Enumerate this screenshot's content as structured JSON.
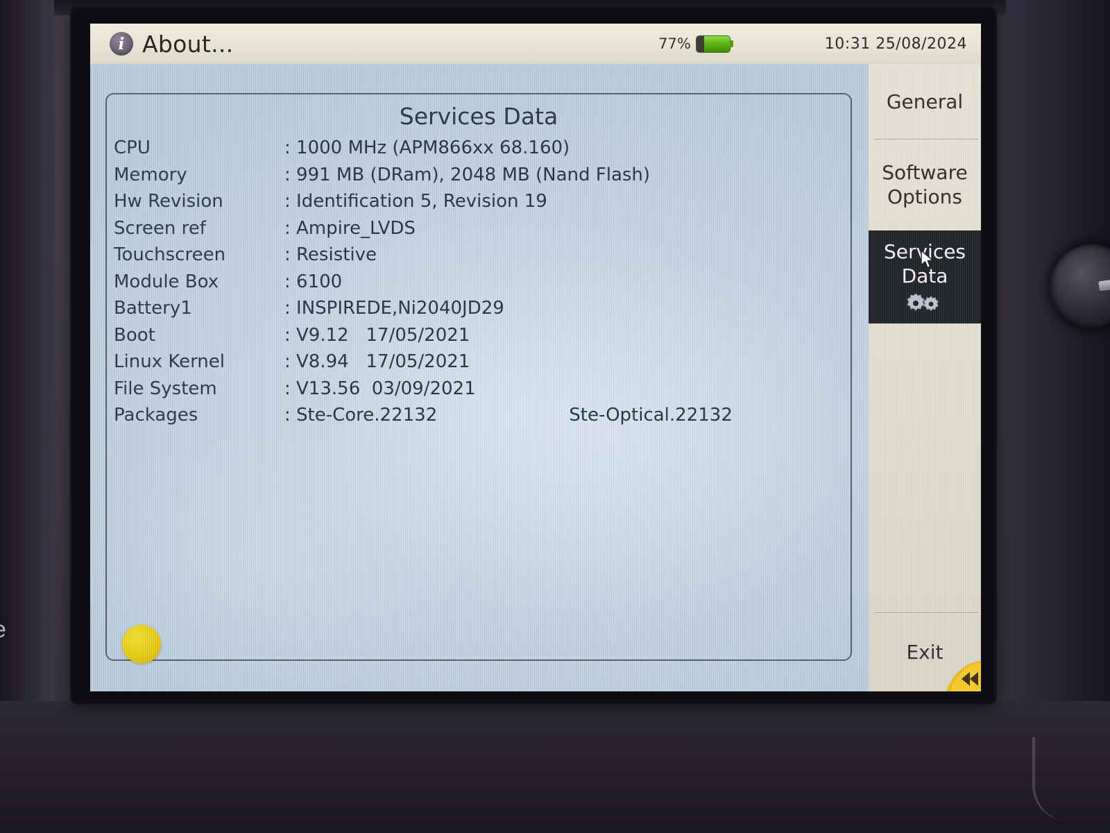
{
  "device": {
    "left_bezel_letter": "e"
  },
  "titlebar": {
    "icon": "info-icon",
    "title": "About...",
    "battery_percent": "77%",
    "battery_icon": "battery-icon",
    "clock": "10:31  25/08/2024"
  },
  "panel": {
    "title": "Services Data",
    "rows": [
      {
        "label": "CPU",
        "value": ": 1000 MHz (APM866xx 68.160)"
      },
      {
        "label": "Memory",
        "value": ": 991 MB (DRam), 2048 MB (Nand Flash)"
      },
      {
        "label": "Hw Revision",
        "value": ": Identification 5, Revision 19"
      },
      {
        "label": "Screen ref",
        "value": ": Ampire_LVDS"
      },
      {
        "label": "Touchscreen",
        "value": ": Resistive"
      },
      {
        "label": "Module Box",
        "value": ": 6100"
      },
      {
        "label": "Battery1",
        "value": ": INSPIREDE,Ni2040JD29"
      },
      {
        "label": "Boot",
        "value": ": V9.12   17/05/2021"
      },
      {
        "label": "Linux Kernel",
        "value": ": V8.94   17/05/2021"
      },
      {
        "label": "File System",
        "value": ": V13.56  03/09/2021"
      },
      {
        "label": "Packages",
        "value": ": Ste-Core.22132",
        "value2": "Ste-Optical.22132"
      }
    ],
    "status_dot": "yellow-status-dot"
  },
  "sidebar": {
    "items": [
      {
        "label": "General",
        "selected": false
      },
      {
        "label": "Software\nOptions",
        "selected": false
      },
      {
        "label": "Services\nData",
        "selected": true,
        "icon": "gears-icon"
      }
    ],
    "exit_label": "Exit",
    "corner_icon": "rewind-arrow-icon"
  },
  "colors": {
    "screen_bg": "#c3d3e0",
    "titlebar_bg": "#e8e3d5",
    "sidebar_bg": "#e0dccf",
    "selected_bg": "#1e2126",
    "accent_yellow": "#e3c90c",
    "battery_green": "#5fb815",
    "text_dark": "#20303f"
  }
}
